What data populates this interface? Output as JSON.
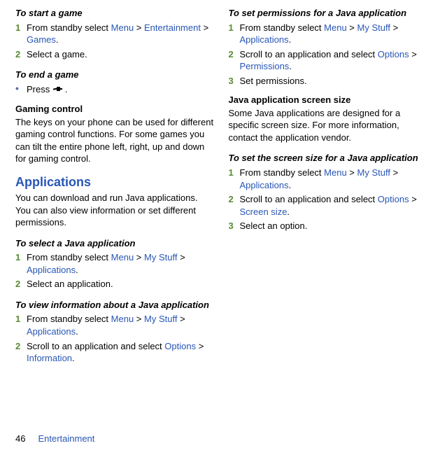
{
  "col1": {
    "h1": "To start a game",
    "s1a": "From standby select ",
    "s1_menu": "Menu",
    "s1_gt1": " > ",
    "s1_ent": "Entertainment",
    "s1_gt2": " > ",
    "s1_games": "Games",
    "s1_dot": ".",
    "s2": "Select a game.",
    "h2": "To end a game",
    "b1a": "Press ",
    "b1b": ".",
    "h3": "Gaming control",
    "p3": "The keys on your phone can be used for different gaming control functions. For some games you can tilt the entire phone left, right, up and down for gaming control.",
    "h4": "Applications",
    "p4": "You can download and run Java applications. You can also view information or set different permissions.",
    "h5": "To select a Java application",
    "s5a": "From standby select ",
    "s5_menu": "Menu",
    "s5_gt1": " > ",
    "s5_mystuff": "My Stuff",
    "s5_gt2": " > ",
    "s5_apps": "Applications",
    "s5_dot": ".",
    "s6": "Select an application.",
    "h6": "To view information about a Java application",
    "s7a": "From standby select ",
    "s7_menu": "Menu",
    "s7_gt1": " > ",
    "s7_mystuff": "My Stuff",
    "s7_gt2": " > ",
    "s7_apps": "Applications",
    "s7_dot": ".",
    "s8a": "Scroll to an application and select ",
    "s8_opt": "Options",
    "s8_gt": " > ",
    "s8_info": "Information",
    "s8_dot": "."
  },
  "col2": {
    "h1": "To set permissions for a Java application",
    "s1a": "From standby select ",
    "s1_menu": "Menu",
    "s1_gt1": " > ",
    "s1_mystuff": "My Stuff",
    "s1_gt2": " > ",
    "s1_apps": "Applications",
    "s1_dot": ".",
    "s2a": "Scroll to an application and select ",
    "s2_opt": "Options",
    "s2_gt": " > ",
    "s2_perm": "Permissions",
    "s2_dot": ".",
    "s3": "Set permissions.",
    "h2": "Java application screen size",
    "p2": "Some Java applications are designed for a specific screen size. For more information, contact the application vendor.",
    "h3": "To set the screen size for a Java application",
    "s4a": "From standby select ",
    "s4_menu": "Menu",
    "s4_gt1": " > ",
    "s4_mystuff": "My Stuff",
    "s4_gt2": " > ",
    "s4_apps": "Applications",
    "s4_dot": ".",
    "s5a": "Scroll to an application and select ",
    "s5_opt": "Options",
    "s5_gt": " > ",
    "s5_size": "Screen size",
    "s5_dot": ".",
    "s6": "Select an option."
  },
  "footer": {
    "page": "46",
    "section": "Entertainment"
  },
  "nums": {
    "n1": "1",
    "n2": "2",
    "n3": "3"
  }
}
